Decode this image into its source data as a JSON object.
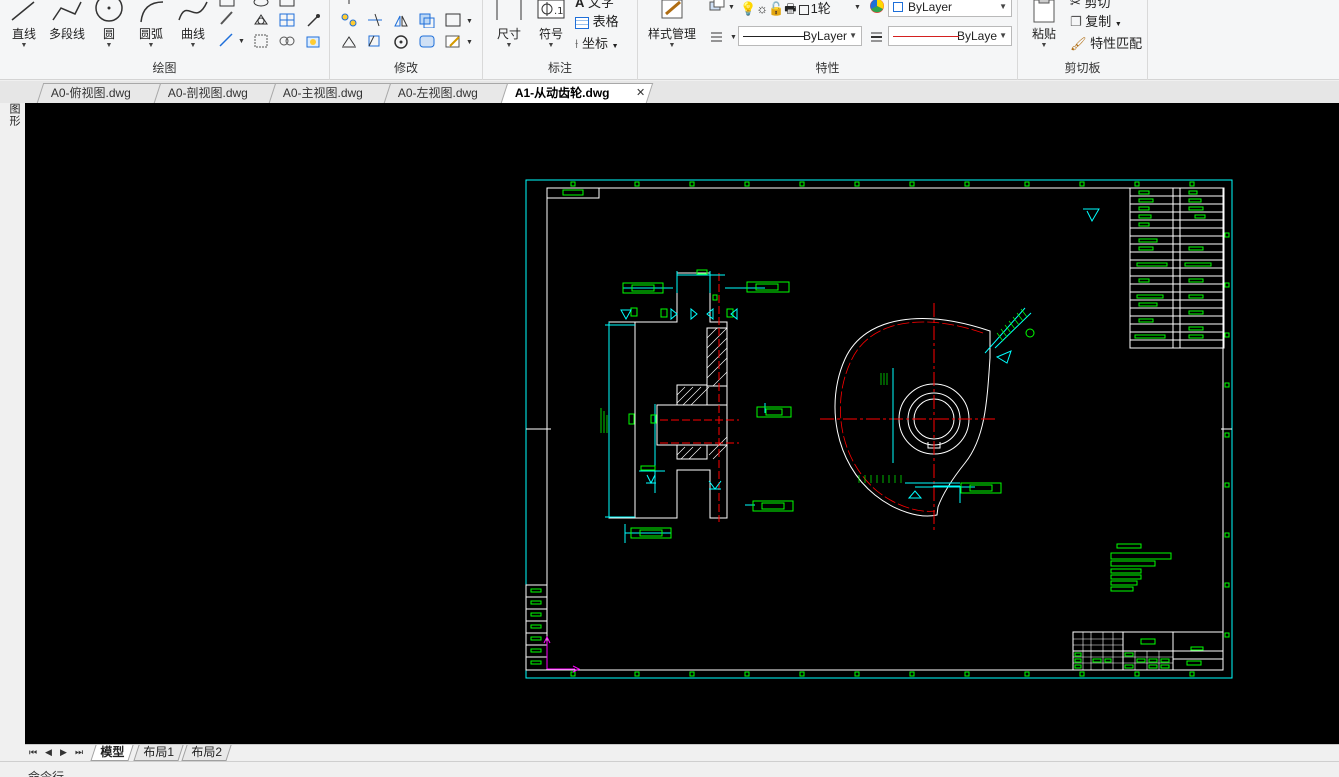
{
  "ribbon": {
    "draw": {
      "label": "绘图",
      "tools": [
        {
          "name": "line",
          "label": "直线"
        },
        {
          "name": "polyline",
          "label": "多段线"
        },
        {
          "name": "circle",
          "label": "圆"
        },
        {
          "name": "arc",
          "label": "圆弧"
        },
        {
          "name": "spline",
          "label": "曲线"
        }
      ]
    },
    "modify": {
      "label": "修改"
    },
    "annotate": {
      "label": "标注",
      "dimension": "尺寸",
      "symbol": "符号",
      "text": "文字",
      "table": "表格",
      "coordinate": "坐标"
    },
    "properties": {
      "label": "特性",
      "style_manager": "样式管理",
      "layer_name": "1轮",
      "color": "ByLayer",
      "linetype": "ByLayer",
      "lineweight": "ByLaye"
    },
    "clipboard": {
      "label": "剪切板",
      "paste": "粘贴",
      "cut": "剪切",
      "copy": "复制",
      "match": "特性匹配"
    }
  },
  "tabs": [
    {
      "label": "A0-俯视图.dwg"
    },
    {
      "label": "A0-剖视图.dwg"
    },
    {
      "label": "A0-主视图.dwg"
    },
    {
      "label": "A0-左视图.dwg"
    },
    {
      "label": "A1-从动齿轮.dwg",
      "active": true
    }
  ],
  "close_glyph": "✕",
  "side_palette": {
    "label": "图形"
  },
  "layout_tabs": [
    {
      "label": "模型",
      "active": true
    },
    {
      "label": "布局1"
    },
    {
      "label": "布局2"
    }
  ],
  "command_line": {
    "label": "命令行"
  },
  "colors": {
    "canvas": "#000000",
    "border": "#00ffff",
    "title_block": "#ffffff",
    "annotation": "#00ff00",
    "centerline": "#ff0000",
    "ucs": "#ff00ff"
  }
}
